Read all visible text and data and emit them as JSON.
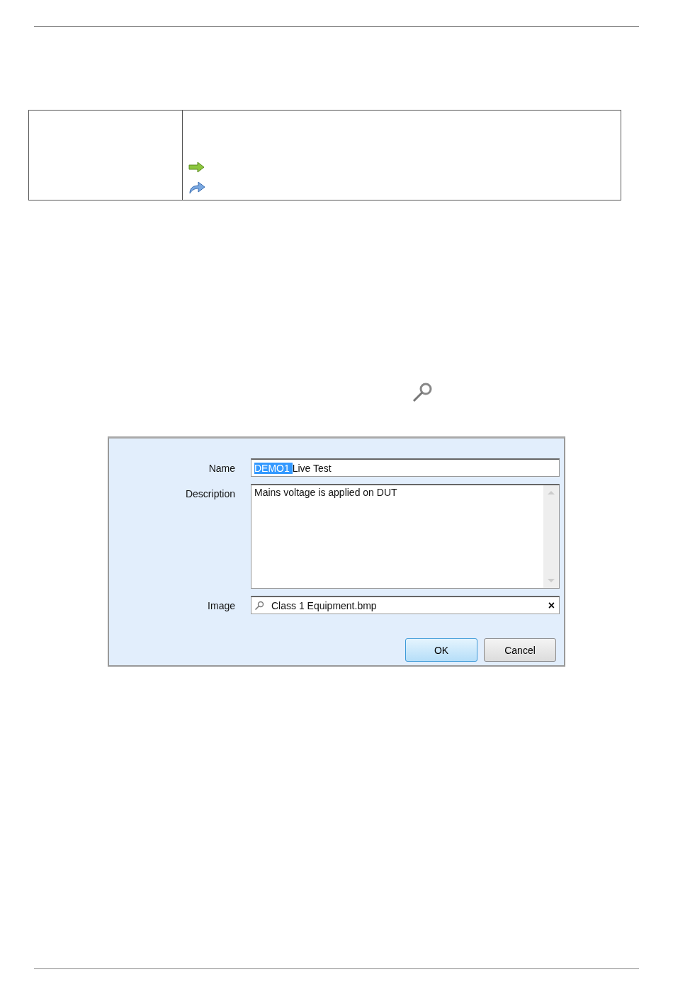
{
  "dialog": {
    "fields": [
      {
        "kind": "text",
        "label": "Name",
        "selected_text": "DEMO1",
        "value": "Live Test"
      },
      {
        "kind": "textarea",
        "label": "Description",
        "value": "Mains voltage is applied on DUT"
      },
      {
        "kind": "file",
        "label": "Image",
        "value": "Class 1 Equipment.bmp",
        "clear": "×"
      }
    ],
    "buttons": [
      {
        "label": "OK",
        "default": true
      },
      {
        "label": "Cancel",
        "default": false
      }
    ]
  }
}
